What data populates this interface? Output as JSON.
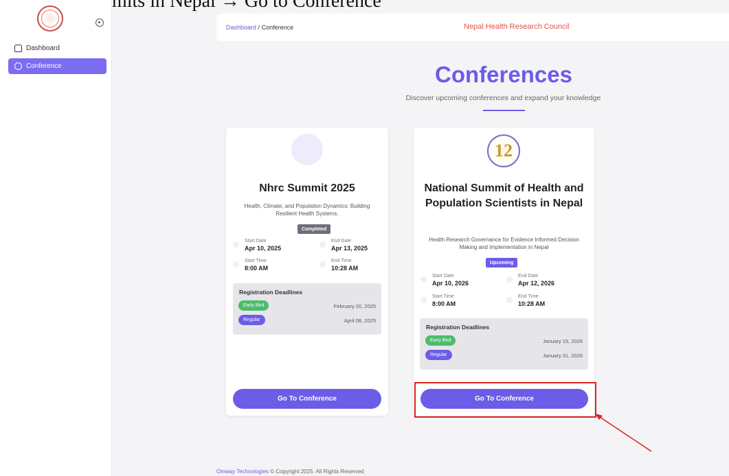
{
  "caption": "Council's Summits in Nepal → Go to Conference",
  "sidebar": {
    "items": [
      {
        "label": "Dashboard",
        "icon": "home-icon"
      },
      {
        "label": "Conference",
        "icon": "conference-icon",
        "active": true
      }
    ]
  },
  "topbar": {
    "breadcrumb_root": "Dashboard",
    "breadcrumb_sep": "/",
    "breadcrumb_current": "Conference",
    "org_name": "Nepal Health Research Council"
  },
  "page": {
    "title": "Conferences",
    "subtitle": "Discover upcoming conferences and expand your knowledge"
  },
  "conferences": [
    {
      "title": "Nhrc Summit 2025",
      "description": "Health, Climate, and Population Dynamics: Building Resilient Health Systems.",
      "status": "Completed",
      "start_date_label": "Start Date",
      "start_date": "Apr 10, 2025",
      "end_date_label": "End Date",
      "end_date": "Apr 13, 2025",
      "start_time_label": "Start Time",
      "start_time": "8:00 AM",
      "end_time_label": "End Time",
      "end_time": "10:28 AM",
      "deadlines_title": "Registration Deadlines",
      "early_bird_label": "Early Bird",
      "early_bird_date": "February 20, 2025",
      "regular_label": "Regular",
      "regular_date": "April 08, 2025",
      "button_label": "Go To Conference"
    },
    {
      "title": "National Summit of Health and Population Scientists in Nepal",
      "emblem_text": "12",
      "description": "Health Research Governance for Evidence Informed Decision Making and Implementation in Nepal",
      "status": "Upcoming",
      "start_date_label": "Start Date",
      "start_date": "Apr 10, 2026",
      "end_date_label": "End Date",
      "end_date": "Apr 12, 2026",
      "start_time_label": "Start Time",
      "start_time": "8:00 AM",
      "end_time_label": "End Time",
      "end_time": "10:28 AM",
      "deadlines_title": "Registration Deadlines",
      "early_bird_label": "Early Bird",
      "early_bird_date": "January 15, 2026",
      "regular_label": "Regular",
      "regular_date": "January 31, 2026",
      "button_label": "Go To Conference"
    }
  ],
  "footer": {
    "brand": "Omway Technologies",
    "text": "© Copyright 2025. All Rights Reserved"
  },
  "colors": {
    "accent": "#6c5ce7",
    "org_red": "#e0524b",
    "early_bird_green": "#4cbb6c",
    "completed_gray": "#6f6f7a",
    "annotation_red": "#e02020"
  }
}
